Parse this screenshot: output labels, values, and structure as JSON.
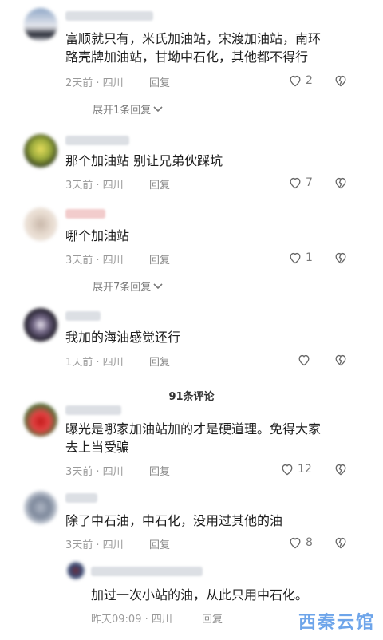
{
  "comments": [
    {
      "text_lines": [
        "富顺就只有，米氏加油站，宋渡加油站，南环",
        "路壳牌加油站，甘坳中石化，其他都不得行"
      ],
      "meta": "2天前 · 四川",
      "reply": "回复",
      "likes": "2"
    },
    {
      "expand": "展开1条回复"
    },
    {
      "text_lines": [
        "那个加油站    别让兄弟伙踩坑"
      ],
      "meta": "3天前 · 四川",
      "reply": "回复",
      "likes": "7"
    },
    {
      "text_lines": [
        "哪个加油站"
      ],
      "meta": "3天前 · 四川",
      "reply": "回复",
      "likes": "1"
    },
    {
      "expand": "展开7条回复"
    },
    {
      "text_lines": [
        "我加的海油感觉还行"
      ],
      "meta": "1天前 · 四川",
      "reply": "回复",
      "likes": ""
    },
    {
      "total": "91条评论"
    },
    {
      "text_lines": [
        "曝光是哪家加油站加的才是硬道理。免得大家",
        "去上当受骗"
      ],
      "meta": "3天前 · 四川",
      "reply": "回复",
      "likes": "12"
    },
    {
      "text_lines": [
        "除了中石油，中石化，没用过其他的油"
      ],
      "meta": "3天前 · 四川",
      "reply": "回复",
      "likes": "8"
    },
    {
      "text_lines": [
        "加过一次小站的油，从此只用中石化。"
      ],
      "meta": "昨天09:09 · 四川",
      "reply": "回复",
      "likes": ""
    }
  ],
  "watermark": "西秦云馆",
  "icons": {
    "like": "heart-outline-icon",
    "dislike": "broken-heart-icon",
    "expand": "chevron-down-icon"
  }
}
